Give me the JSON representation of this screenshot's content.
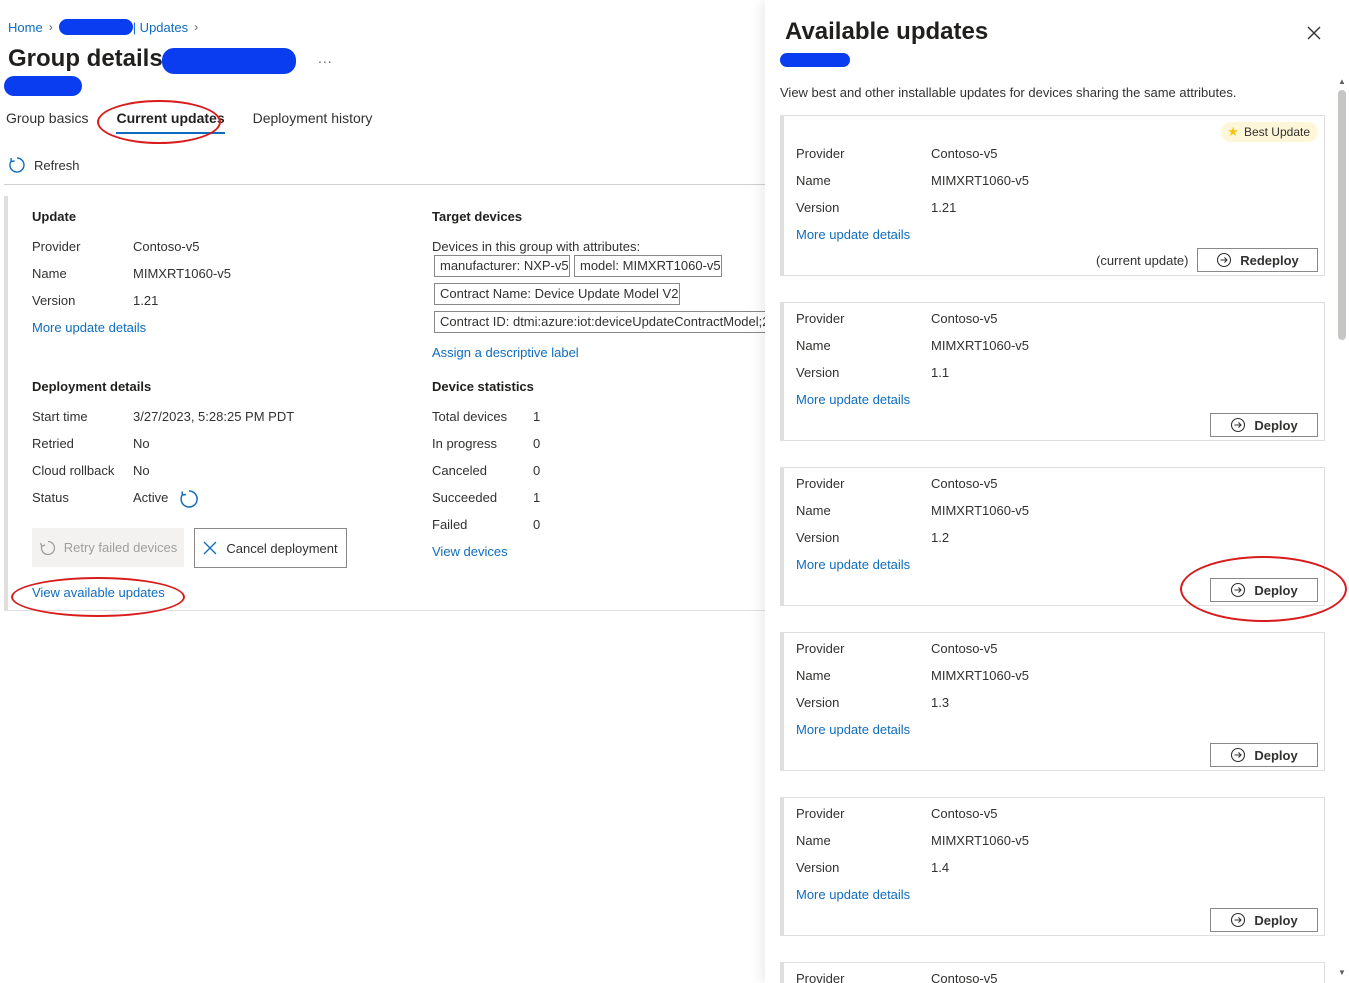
{
  "breadcrumb": {
    "home": "Home",
    "updates": "| Updates"
  },
  "page": {
    "title": "Group details:",
    "more": "..."
  },
  "tabs": [
    {
      "label": "Group basics"
    },
    {
      "label": "Current updates"
    },
    {
      "label": "Deployment history"
    }
  ],
  "toolbar": {
    "refresh": "Refresh"
  },
  "update": {
    "heading": "Update",
    "provider_label": "Provider",
    "provider": "Contoso-v5",
    "name_label": "Name",
    "name": "MIMXRT1060-v5",
    "version_label": "Version",
    "version": "1.21",
    "more": "More update details"
  },
  "target": {
    "heading": "Target devices",
    "desc": "Devices in this group with attributes:",
    "chips": [
      "manufacturer: NXP-v5",
      "model: MIMXRT1060-v5",
      "Contract Name: Device Update Model V2",
      "Contract ID: dtmi:azure:iot:deviceUpdateContractModel;2"
    ],
    "assign": "Assign a descriptive label"
  },
  "deployment": {
    "heading": "Deployment details",
    "start_label": "Start time",
    "start": "3/27/2023, 5:28:25 PM PDT",
    "retried_label": "Retried",
    "retried": "No",
    "rollback_label": "Cloud rollback",
    "rollback": "No",
    "status_label": "Status",
    "status": "Active"
  },
  "stats": {
    "heading": "Device statistics",
    "total_label": "Total devices",
    "total": "1",
    "progress_label": "In progress",
    "progress": "0",
    "canceled_label": "Canceled",
    "canceled": "0",
    "succeeded_label": "Succeeded",
    "succeeded": "1",
    "failed_label": "Failed",
    "failed": "0",
    "view": "View devices"
  },
  "actions": {
    "retry": "Retry failed devices",
    "cancel": "Cancel deployment",
    "view_available": "View available updates"
  },
  "panel": {
    "title": "Available updates",
    "desc": "View best and other installable updates for devices sharing the same attributes.",
    "labels": {
      "provider": "Provider",
      "name": "Name",
      "version": "Version",
      "more": "More update details"
    },
    "best_badge": "Best Update",
    "current_tag": "(current update)",
    "redeploy": "Redeploy",
    "deploy": "Deploy",
    "cards": [
      {
        "provider": "Contoso-v5",
        "name": "MIMXRT1060-v5",
        "version": "1.21"
      },
      {
        "provider": "Contoso-v5",
        "name": "MIMXRT1060-v5",
        "version": "1.1"
      },
      {
        "provider": "Contoso-v5",
        "name": "MIMXRT1060-v5",
        "version": "1.2"
      },
      {
        "provider": "Contoso-v5",
        "name": "MIMXRT1060-v5",
        "version": "1.3"
      },
      {
        "provider": "Contoso-v5",
        "name": "MIMXRT1060-v5",
        "version": "1.4"
      },
      {
        "provider": "Contoso-v5",
        "name": "",
        "version": ""
      }
    ]
  }
}
